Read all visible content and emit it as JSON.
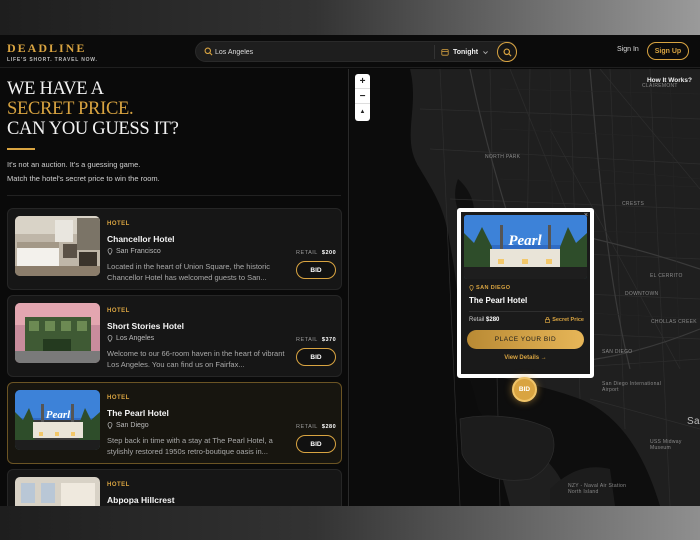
{
  "header": {
    "logo": "DEADLINE",
    "tagline": "LIFE'S SHORT. TRAVEL NOW.",
    "search_value": "Los Angeles",
    "date_label": "Tonight",
    "sign_in": "Sign In",
    "sign_up": "Sign Up"
  },
  "hero": {
    "line1": "WE HAVE A",
    "line2": "SECRET PRICE.",
    "line3": "CAN YOU GUESS IT?",
    "sub1": "It's not an auction. It's a guessing game.",
    "sub2": "Match the hotel's secret price to win the room."
  },
  "hotels": [
    {
      "type": "HOTEL",
      "name": "Chancellor Hotel",
      "location": "San Francisco",
      "desc": "Located in the heart of Union Square, the historic Chancellor Hotel has welcomed guests to San...",
      "retail_label": "RETAIL",
      "retail": "$200",
      "bid": "BID"
    },
    {
      "type": "HOTEL",
      "name": "Short Stories Hotel",
      "location": "Los Angeles",
      "desc": "Welcome to our 66-room haven in the heart of vibrant Los Angeles. You can find us on Fairfax...",
      "retail_label": "RETAIL",
      "retail": "$370",
      "bid": "BID"
    },
    {
      "type": "HOTEL",
      "name": "The Pearl Hotel",
      "location": "San Diego",
      "desc": "Step back in time with a stay at The Pearl Hotel, a stylishly restored 1950s retro-boutique oasis in...",
      "retail_label": "RETAIL",
      "retail": "$280",
      "bid": "BID"
    },
    {
      "type": "HOTEL",
      "name": "Abpopa Hillcrest",
      "location": "",
      "desc": "",
      "retail_label": "",
      "retail": "",
      "bid": ""
    }
  ],
  "map": {
    "how_it_works": "How It Works?",
    "zoom_in": "+",
    "zoom_out": "−",
    "compass": "▲",
    "pin_label": "BID",
    "labels": {
      "l1": "SAN DIEGO",
      "l2": "SAN DIEGO",
      "l3": "San Diego International Airport",
      "l4": "NZY - Naval Air Station North Island",
      "l5": "Sa",
      "l6": "USS Midway Museum",
      "l7": "CLAIREMONT",
      "l8": "CRESTS",
      "l9": "EL CERRITO",
      "l10": "DOWNTOWN",
      "l11": "NORTH PARK",
      "l12": "CHOLLAS CREEK"
    },
    "popup": {
      "close": "×",
      "sign_text": "Pearl",
      "location": "SAN DIEGO",
      "name": "The Pearl Hotel",
      "retail_label": "Retail",
      "retail": "$280",
      "secret": "Secret Price",
      "cta": "PLACE YOUR BID",
      "view": "View Details →"
    }
  },
  "colors": {
    "accent": "#d9a441",
    "bg": "#0a0a0a",
    "card": "#161616"
  }
}
